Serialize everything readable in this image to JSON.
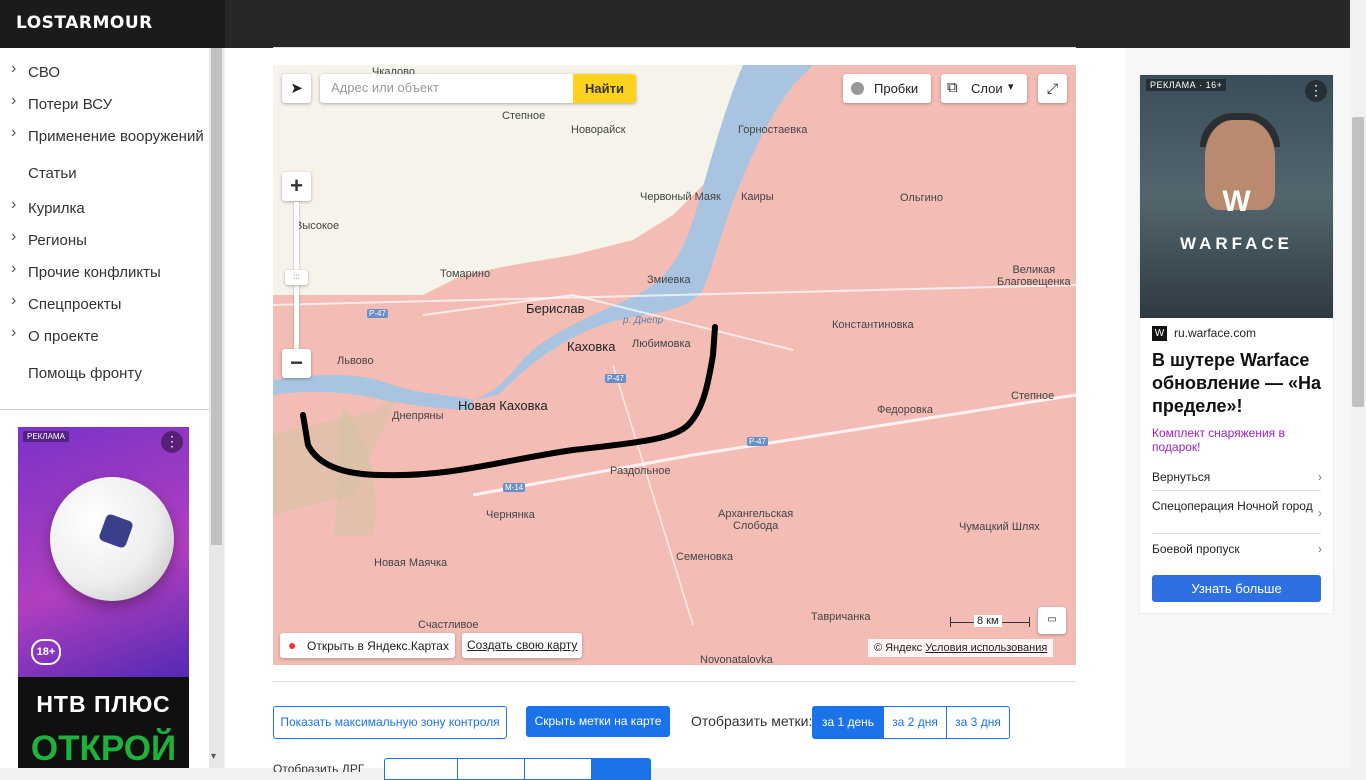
{
  "header": {
    "logo": "LOSTARMOUR"
  },
  "sidebar": {
    "items": [
      {
        "label": "СВО",
        "has_chevron": true
      },
      {
        "label": "Потери ВСУ",
        "has_chevron": true
      },
      {
        "label": "Применение вооружений",
        "has_chevron": true
      },
      {
        "label": "Статьи",
        "has_chevron": false
      },
      {
        "label": "Курилка",
        "has_chevron": true
      },
      {
        "label": "Регионы",
        "has_chevron": true
      },
      {
        "label": "Прочие конфликты",
        "has_chevron": true
      },
      {
        "label": "Спецпроекты",
        "has_chevron": true
      },
      {
        "label": "О проекте",
        "has_chevron": true
      },
      {
        "label": "Помощь фронту",
        "has_chevron": false
      }
    ],
    "ad": {
      "tag": "РЕКЛАМА",
      "age": "18+",
      "brand": "НТВ ПЛЮС",
      "cta_text": "ОТКРОЙ"
    }
  },
  "map": {
    "search_placeholder": "Адрес или объект",
    "search_button": "Найти",
    "traffic_label": "Пробки",
    "layers_label": "Слои",
    "open_yandex": "Открыть в Яндекс.Картах",
    "create_map": "Создать свою карту",
    "scale": "8 км",
    "copyright": "© Яндекс",
    "terms": "Условия использования",
    "labels": {
      "chkalovo": "Чкалово",
      "stepnoe1": "Степное",
      "novoraysk": "Новорайск",
      "gornostaevka": "Горностаевка",
      "chervonyi_mayak": "Червоный Маяк",
      "kairy": "Каиры",
      "olgino": "Ольгино",
      "vysokoe": "Высокое",
      "tomarino": "Томарино",
      "zmievka": "Змиевка",
      "velikaya_blag": "Великая\nБлаговещенка",
      "beryslav": "Берислав",
      "dnepr": "р. Днепр",
      "kakhovka": "Каховка",
      "lyubimovka": "Любимовка",
      "konstantinovka": "Константиновка",
      "lvovo": "Львово",
      "nova_kakhovka": "Новая Каховка",
      "dneprany": "Днепряны",
      "fedorovka": "Федоровка",
      "stepnoe2": "Степное",
      "razdolnoe": "Раздольное",
      "chernyanka": "Чернянка",
      "arkh_sloboda": "Архангельская\nСлобода",
      "chumatsky": "Чумацкий Шлях",
      "nova_mayachka": "Новая Маячка",
      "semenovka": "Семеновка",
      "schastlivoe": "Счастливое",
      "tavrichanka": "Тавричанка",
      "novonatalovka": "Novonatalovka",
      "road_r47": "Р-47",
      "road_m14": "М-14"
    }
  },
  "controls": {
    "show_max_zone": "Показать максимальную зону контроля",
    "hide_marks": "Скрыть метки на карте",
    "marks_label": "Отобразить метки:",
    "periods": [
      "за 1 день",
      "за 2 дня",
      "за 3 дня"
    ],
    "active_period": 0,
    "next_row_label": "Отобразить ДРГ"
  },
  "right_ad": {
    "tag": "РЕКЛАМА · 16+",
    "game_name": "WARFACE",
    "domain": "ru.warface.com",
    "headline": "В шутере Warface обновление — «На пределе»!",
    "subtext": "Комплект снаряжения в подарок!",
    "links": [
      "Вернуться",
      "Спецоперация Ночной город",
      "Боевой пропуск"
    ],
    "cta": "Узнать больше"
  }
}
